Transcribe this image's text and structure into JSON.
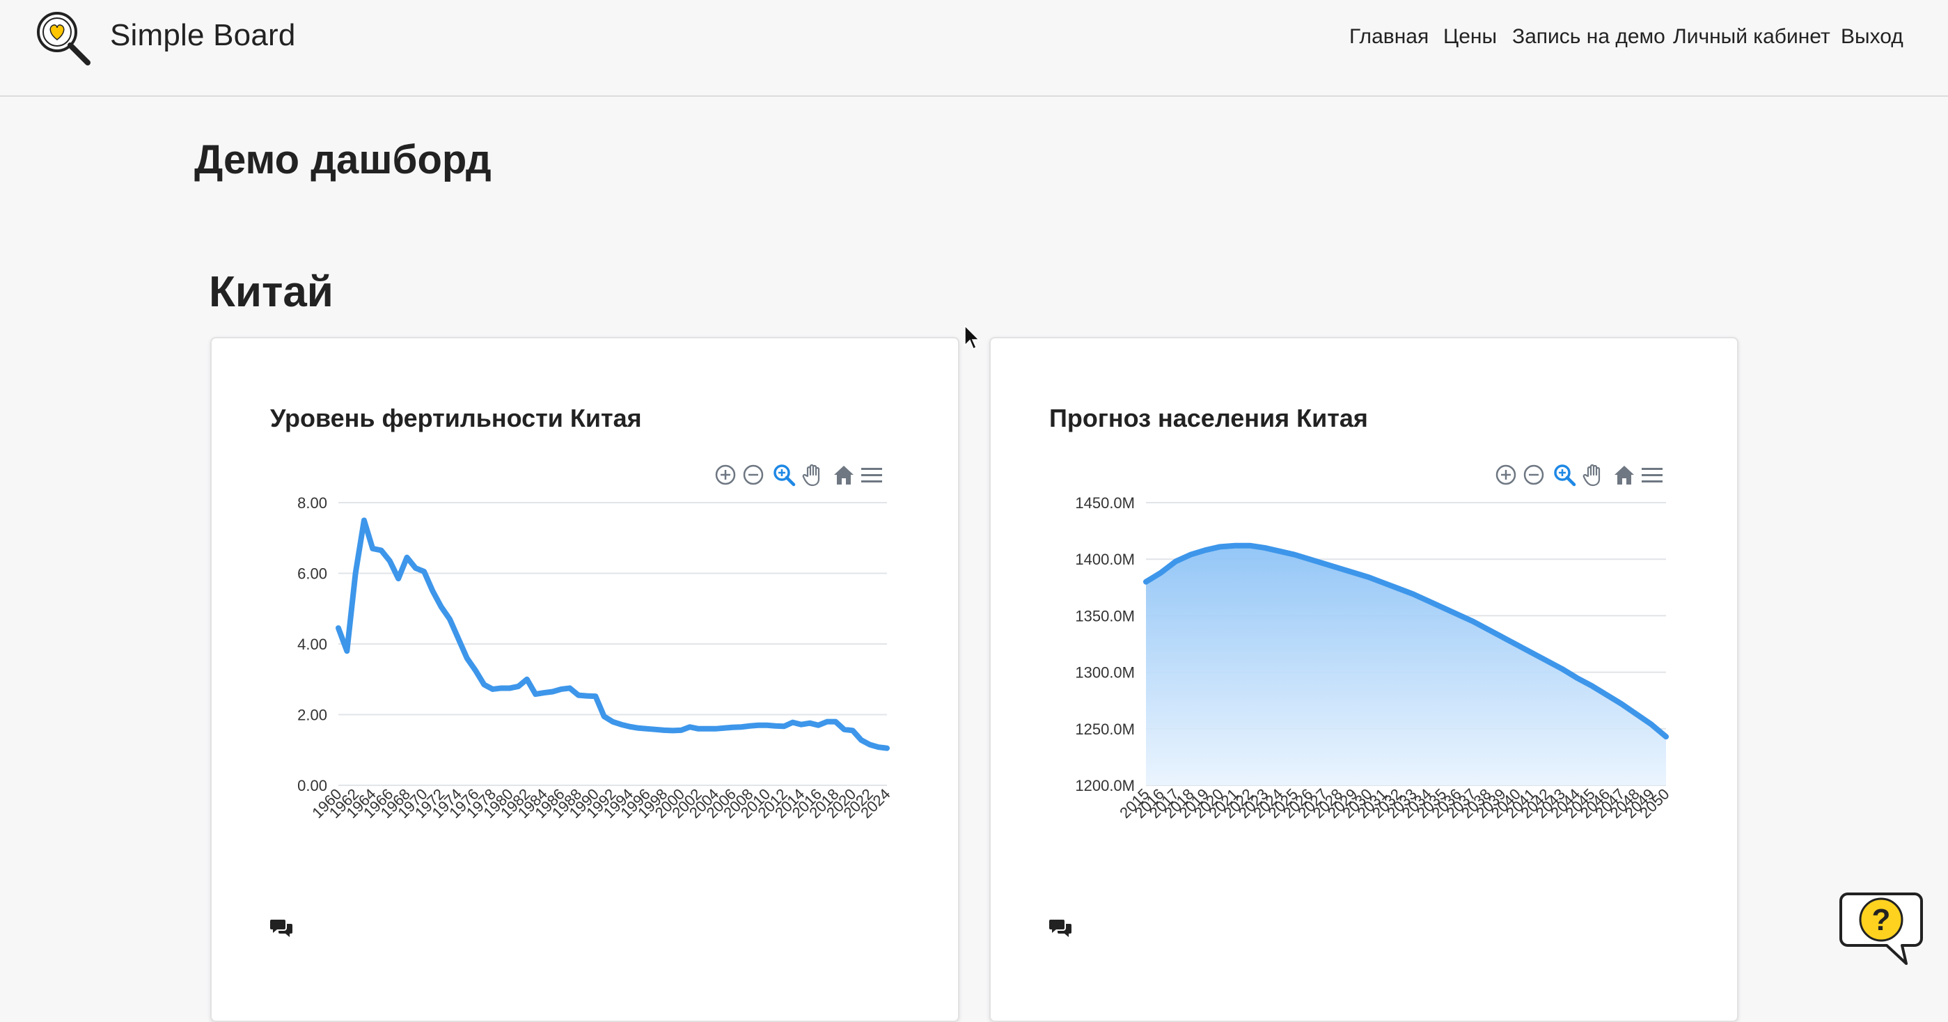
{
  "brand": {
    "name": "Simple Board"
  },
  "nav": {
    "items": [
      {
        "label": "Главная"
      },
      {
        "label": "Цены"
      },
      {
        "label": "Запись на демо"
      },
      {
        "label": "Личный кабинет"
      },
      {
        "label": "Выход"
      }
    ]
  },
  "page": {
    "title": "Демо дашборд",
    "section_title": "Китай"
  },
  "icons": {
    "logo": "magnifier-heart-logo-icon",
    "zoom_in": "zoom-in-icon",
    "zoom_out": "zoom-out-icon",
    "selection_zoom": "selection-zoom-icon",
    "pan": "pan-hand-icon",
    "reset": "home-icon",
    "menu": "hamburger-menu-icon",
    "comments": "comments-icon",
    "help": "help-bubble-icon"
  },
  "colors": {
    "line": "#3d96ea",
    "area_top": "#8ec3f6",
    "area_bottom": "#e8f3fe",
    "toolbar_active": "#1e88e5",
    "toolbar": "#6e7782",
    "help_yellow": "#ffd21f"
  },
  "chart_data": [
    {
      "type": "line",
      "title": "Уровень фертильности Китая",
      "x": [
        1960,
        1961,
        1962,
        1963,
        1964,
        1965,
        1966,
        1967,
        1968,
        1969,
        1970,
        1971,
        1972,
        1973,
        1974,
        1975,
        1976,
        1977,
        1978,
        1979,
        1980,
        1981,
        1982,
        1983,
        1984,
        1985,
        1986,
        1987,
        1988,
        1989,
        1990,
        1991,
        1992,
        1993,
        1994,
        1995,
        1996,
        1997,
        1998,
        1999,
        2000,
        2001,
        2002,
        2003,
        2004,
        2005,
        2006,
        2007,
        2008,
        2009,
        2010,
        2011,
        2012,
        2013,
        2014,
        2015,
        2016,
        2017,
        2018,
        2019,
        2020,
        2021,
        2022,
        2023,
        2024
      ],
      "y": [
        4.45,
        3.8,
        6.0,
        7.5,
        6.7,
        6.65,
        6.35,
        5.85,
        6.45,
        6.15,
        6.05,
        5.5,
        5.05,
        4.7,
        4.15,
        3.6,
        3.25,
        2.85,
        2.72,
        2.75,
        2.75,
        2.8,
        3.0,
        2.58,
        2.62,
        2.65,
        2.72,
        2.75,
        2.55,
        2.53,
        2.52,
        1.95,
        1.8,
        1.72,
        1.66,
        1.62,
        1.6,
        1.58,
        1.56,
        1.55,
        1.56,
        1.65,
        1.6,
        1.6,
        1.6,
        1.62,
        1.64,
        1.65,
        1.68,
        1.7,
        1.7,
        1.68,
        1.67,
        1.78,
        1.72,
        1.76,
        1.7,
        1.8,
        1.8,
        1.58,
        1.55,
        1.28,
        1.15,
        1.08,
        1.05
      ],
      "x_tick_labels": [
        "1960",
        "1962",
        "1964",
        "1966",
        "1968",
        "1970",
        "1972",
        "1974",
        "1976",
        "1978",
        "1980",
        "1982",
        "1984",
        "1986",
        "1988",
        "1990",
        "1992",
        "1994",
        "1996",
        "1998",
        "2000",
        "2002",
        "2004",
        "2006",
        "2008",
        "2010",
        "2012",
        "2014",
        "2016",
        "2018",
        "2020",
        "2022",
        "2024"
      ],
      "y_tick_labels": [
        "0.00",
        "2.00",
        "4.00",
        "6.00",
        "8.00"
      ],
      "ylim": [
        0,
        8
      ],
      "grid": true,
      "xlabel": "",
      "ylabel": ""
    },
    {
      "type": "area",
      "title": "Прогноз населения Китая",
      "x": [
        2015,
        2016,
        2017,
        2018,
        2019,
        2020,
        2021,
        2022,
        2023,
        2024,
        2025,
        2026,
        2027,
        2028,
        2029,
        2030,
        2031,
        2032,
        2033,
        2034,
        2035,
        2036,
        2037,
        2038,
        2039,
        2040,
        2041,
        2042,
        2043,
        2044,
        2045,
        2046,
        2047,
        2048,
        2049,
        2050
      ],
      "y": [
        1380,
        1388,
        1398,
        1404,
        1408,
        1411,
        1412,
        1412,
        1410,
        1407,
        1404,
        1400,
        1396,
        1392,
        1388,
        1384,
        1379,
        1374,
        1369,
        1363,
        1357,
        1351,
        1345,
        1338,
        1331,
        1324,
        1317,
        1310,
        1303,
        1295,
        1288,
        1280,
        1272,
        1263,
        1254,
        1243
      ],
      "x_tick_labels": [
        "2015",
        "2016",
        "2017",
        "2018",
        "2019",
        "2020",
        "2021",
        "2022",
        "2023",
        "2024",
        "2025",
        "2026",
        "2027",
        "2028",
        "2029",
        "2030",
        "2031",
        "2032",
        "2033",
        "2034",
        "2035",
        "2036",
        "2037",
        "2038",
        "2039",
        "2040",
        "2041",
        "2042",
        "2043",
        "2044",
        "2045",
        "2046",
        "2047",
        "2048",
        "2049",
        "2050"
      ],
      "y_tick_labels": [
        "1200.0M",
        "1250.0M",
        "1300.0M",
        "1350.0M",
        "1400.0M",
        "1450.0M"
      ],
      "ylim": [
        1200,
        1450
      ],
      "grid": true,
      "xlabel": "",
      "ylabel": ""
    }
  ]
}
